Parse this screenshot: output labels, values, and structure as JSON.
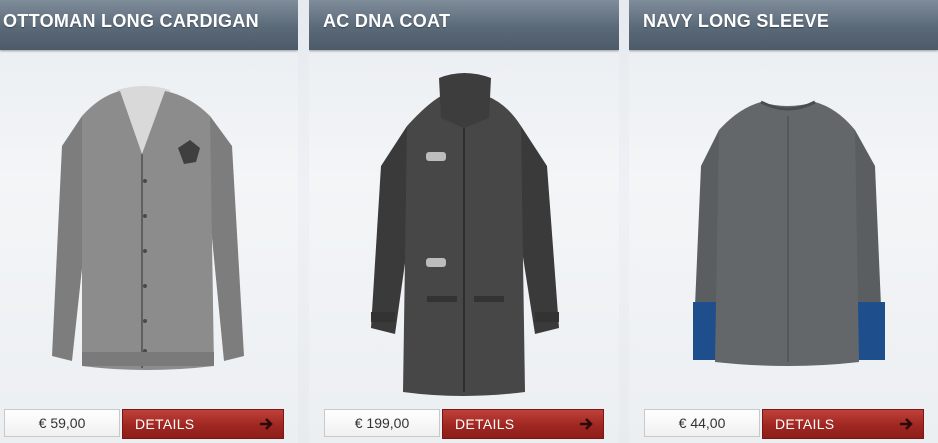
{
  "products": [
    {
      "title": "OTTOMAN LONG CARDIGAN",
      "price": "€ 59,00",
      "details_label": "DETAILS",
      "image": "cardigan-image"
    },
    {
      "title": "AC DNA COAT",
      "price": "€ 199,00",
      "details_label": "DETAILS",
      "image": "coat-image"
    },
    {
      "title": "NAVY LONG SLEEVE",
      "price": "€ 44,00",
      "details_label": "DETAILS",
      "image": "longsleeve-image"
    }
  ],
  "icons": {
    "arrow": "arrow-right-icon"
  },
  "colors": {
    "title_bar": "#5a6978",
    "details_button": "#9f2722",
    "price_text": "#333333"
  }
}
